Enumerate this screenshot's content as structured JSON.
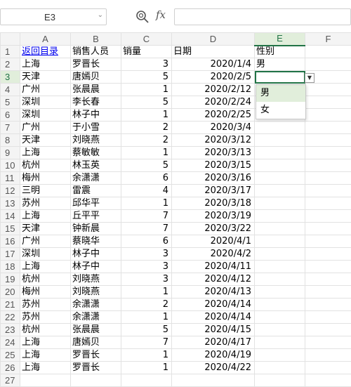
{
  "formula_bar": {
    "name_box": "E3",
    "fx_label": "fx",
    "formula": ""
  },
  "columns": [
    "A",
    "B",
    "C",
    "D",
    "E",
    "F"
  ],
  "rows": [
    {
      "n": "1",
      "a": "返回目录",
      "b": "销售人员",
      "c": "销量",
      "d": "日期",
      "e": "性别"
    },
    {
      "n": "2",
      "a": "上海",
      "b": "罗晋长",
      "c": "3",
      "d": "2020/1/4",
      "e": "男"
    },
    {
      "n": "3",
      "a": "天津",
      "b": "唐嫣贝",
      "c": "5",
      "d": "2020/2/5",
      "e": ""
    },
    {
      "n": "4",
      "a": "广州",
      "b": "张晨晨",
      "c": "1",
      "d": "2020/2/12",
      "e": ""
    },
    {
      "n": "5",
      "a": "深圳",
      "b": "李长春",
      "c": "5",
      "d": "2020/2/24",
      "e": ""
    },
    {
      "n": "6",
      "a": "深圳",
      "b": "林子中",
      "c": "1",
      "d": "2020/2/25",
      "e": ""
    },
    {
      "n": "7",
      "a": "广州",
      "b": "于小雪",
      "c": "2",
      "d": "2020/3/4",
      "e": ""
    },
    {
      "n": "8",
      "a": "天津",
      "b": "刘晓燕",
      "c": "2",
      "d": "2020/3/12",
      "e": ""
    },
    {
      "n": "9",
      "a": "上海",
      "b": "蔡敏敏",
      "c": "1",
      "d": "2020/3/13",
      "e": ""
    },
    {
      "n": "10",
      "a": "杭州",
      "b": "林玉英",
      "c": "5",
      "d": "2020/3/15",
      "e": ""
    },
    {
      "n": "11",
      "a": "梅州",
      "b": "余潇潇",
      "c": "6",
      "d": "2020/3/16",
      "e": ""
    },
    {
      "n": "12",
      "a": "三明",
      "b": "雷震",
      "c": "4",
      "d": "2020/3/17",
      "e": ""
    },
    {
      "n": "13",
      "a": "苏州",
      "b": "邱华平",
      "c": "1",
      "d": "2020/3/18",
      "e": ""
    },
    {
      "n": "14",
      "a": "上海",
      "b": "丘平平",
      "c": "7",
      "d": "2020/3/19",
      "e": ""
    },
    {
      "n": "15",
      "a": "天津",
      "b": "钟新晨",
      "c": "7",
      "d": "2020/3/22",
      "e": ""
    },
    {
      "n": "16",
      "a": "广州",
      "b": "蔡晓华",
      "c": "6",
      "d": "2020/4/1",
      "e": ""
    },
    {
      "n": "17",
      "a": "深圳",
      "b": "林子中",
      "c": "3",
      "d": "2020/4/2",
      "e": ""
    },
    {
      "n": "18",
      "a": "上海",
      "b": "林子中",
      "c": "3",
      "d": "2020/4/11",
      "e": ""
    },
    {
      "n": "19",
      "a": "杭州",
      "b": "刘晓燕",
      "c": "3",
      "d": "2020/4/12",
      "e": ""
    },
    {
      "n": "20",
      "a": "梅州",
      "b": "刘晓燕",
      "c": "1",
      "d": "2020/4/13",
      "e": ""
    },
    {
      "n": "21",
      "a": "苏州",
      "b": "余潇潇",
      "c": "2",
      "d": "2020/4/14",
      "e": ""
    },
    {
      "n": "22",
      "a": "苏州",
      "b": "余潇潇",
      "c": "1",
      "d": "2020/4/14",
      "e": ""
    },
    {
      "n": "23",
      "a": "杭州",
      "b": "张晨晨",
      "c": "5",
      "d": "2020/4/15",
      "e": ""
    },
    {
      "n": "24",
      "a": "上海",
      "b": "唐嫣贝",
      "c": "7",
      "d": "2020/4/17",
      "e": ""
    },
    {
      "n": "25",
      "a": "上海",
      "b": "罗晋长",
      "c": "1",
      "d": "2020/4/19",
      "e": ""
    },
    {
      "n": "26",
      "a": "上海",
      "b": "罗晋长",
      "c": "1",
      "d": "2020/4/22",
      "e": ""
    },
    {
      "n": "27",
      "a": "",
      "b": "",
      "c": "",
      "d": "",
      "e": ""
    }
  ],
  "dropdown": {
    "options": [
      "男",
      "女"
    ]
  },
  "colors": {
    "accent": "#217346",
    "link": "#0000ee"
  }
}
